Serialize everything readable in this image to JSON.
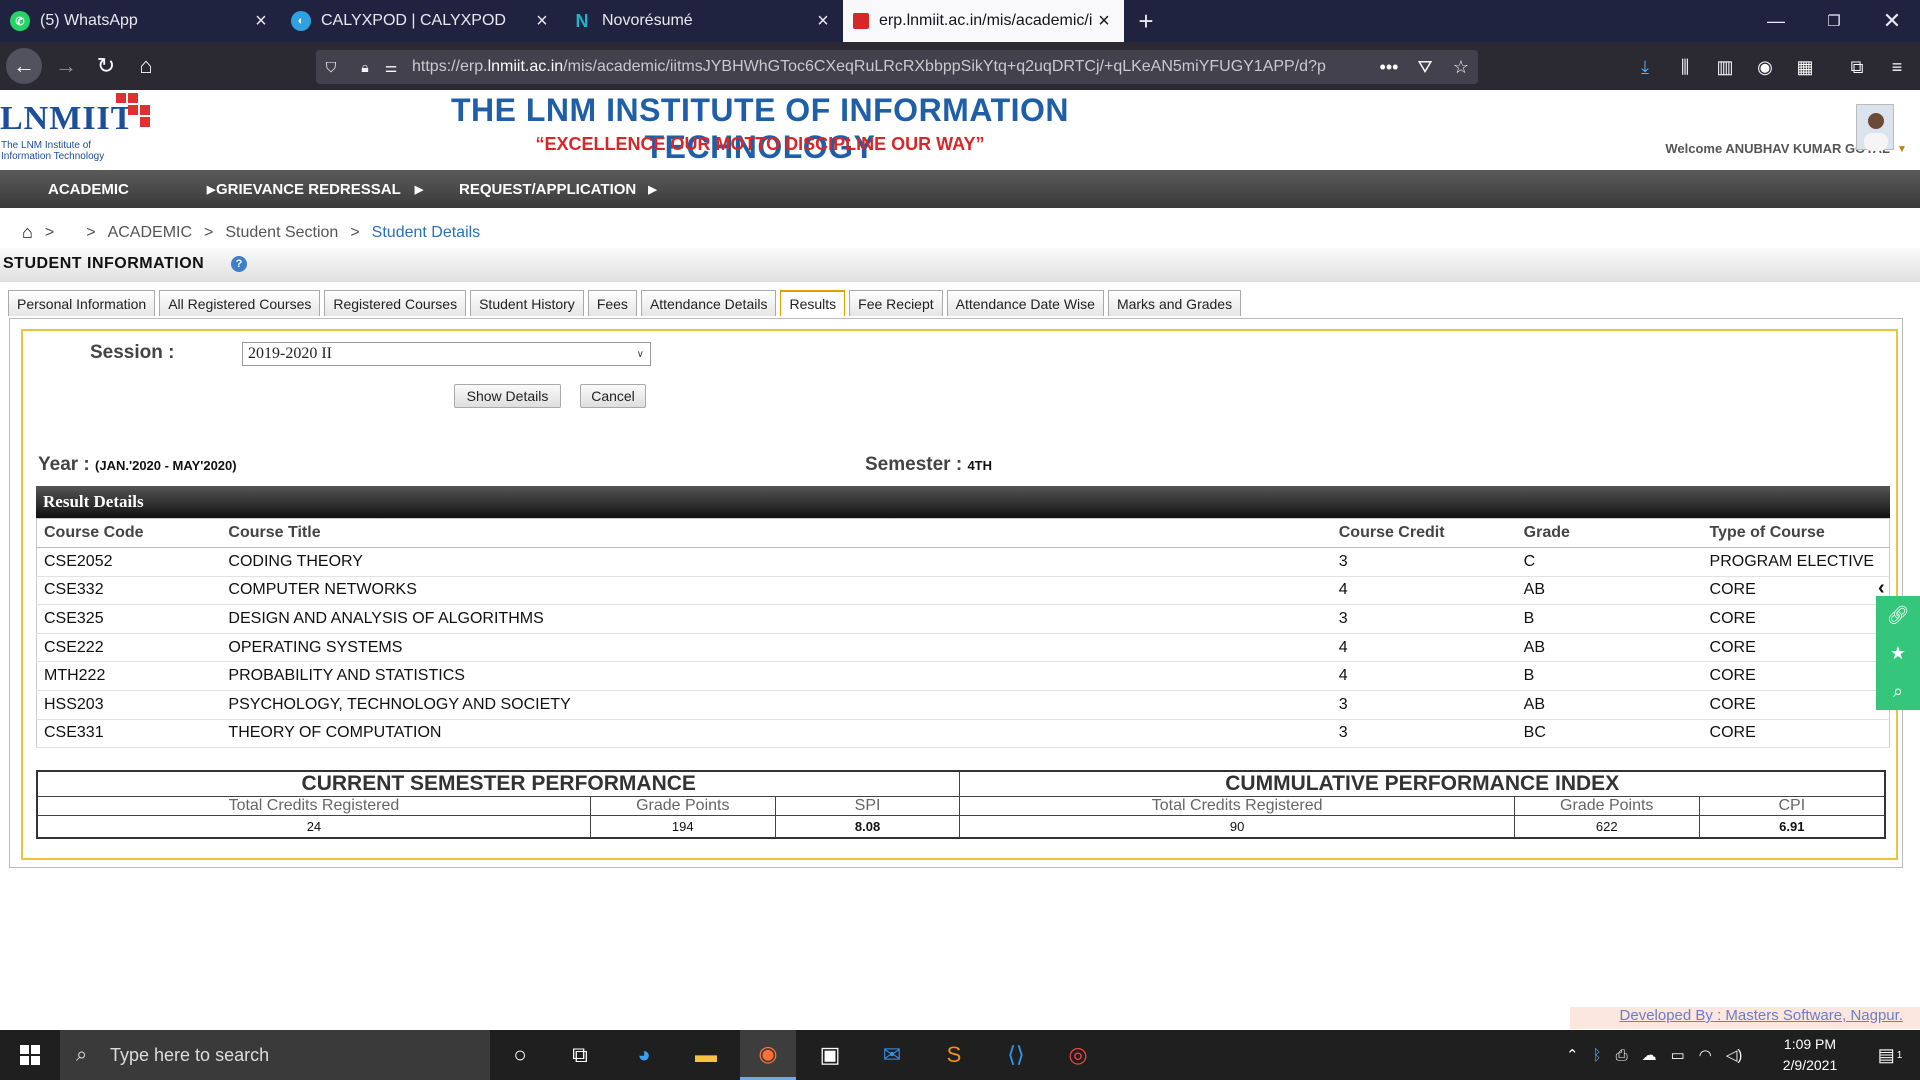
{
  "browser": {
    "tabs": [
      {
        "title": "(5) WhatsApp",
        "icon": "whatsapp-icon",
        "color": "#25d366"
      },
      {
        "title": "CALYXPOD | CALYXPOD",
        "icon": "calyxpod-icon",
        "color": "#2fa0e0"
      },
      {
        "title": "Novorésumé",
        "icon": "novoresume-icon",
        "color": "#1fb5c9"
      },
      {
        "title": "erp.lnmiit.ac.in/mis/academic/i",
        "icon": "lnmiit-favicon",
        "color": "#d62828"
      }
    ],
    "url_prefix": "https://erp.",
    "url_host": "lnmiit.ac.in",
    "url_rest": "/mis/academic/iitmsJYBHWhGToc6CXeqRuLRcRXbbppSikYtq+q2uqDRTCj/+qLKeAN5miYFUGY1APP/d?p"
  },
  "site": {
    "logo_text": "LNMIIT",
    "logo_sub": "The LNM Institute of Information Technology",
    "institute": "THE LNM INSTITUTE OF INFORMATION TECHNOLOGY",
    "motto": "“EXCELLENCE OUR MOTTO DISCIPLINE OUR WAY”",
    "welcome": "Welcome ANUBHAV KUMAR GOYAL",
    "menu": [
      "ACADEMIC",
      "GRIEVANCE REDRESSAL",
      "REQUEST/APPLICATION"
    ]
  },
  "breadcrumb": {
    "sep": ">",
    "items": [
      "ACADEMIC",
      "Student Section"
    ],
    "current": "Student Details"
  },
  "section_title": "STUDENT INFORMATION",
  "page_tabs": [
    "Personal Information",
    "All Registered Courses",
    "Registered Courses",
    "Student History",
    "Fees",
    "Attendance Details",
    "Results",
    "Fee Reciept",
    "Attendance Date Wise",
    "Marks and Grades"
  ],
  "form": {
    "session_label": "Session :",
    "session_value": "2019-2020 II",
    "show_btn": "Show Details",
    "cancel_btn": "Cancel"
  },
  "info": {
    "year_label": "Year :",
    "year_value": "(JAN.'2020 - MAY'2020)",
    "semester_label": "Semester :",
    "semester_value": "4TH"
  },
  "results": {
    "title": "Result Details",
    "columns": [
      "Course Code",
      "Course Title",
      "Course Credit",
      "Grade",
      "Type of Course"
    ],
    "rows": [
      [
        "CSE2052",
        "CODING THEORY",
        "3",
        "C",
        "PROGRAM ELECTIVE"
      ],
      [
        "CSE332",
        "COMPUTER NETWORKS",
        "4",
        "AB",
        "CORE"
      ],
      [
        "CSE325",
        "DESIGN AND ANALYSIS OF ALGORITHMS",
        "3",
        "B",
        "CORE"
      ],
      [
        "CSE222",
        "OPERATING SYSTEMS",
        "4",
        "AB",
        "CORE"
      ],
      [
        "MTH222",
        "PROBABILITY AND STATISTICS",
        "4",
        "B",
        "CORE"
      ],
      [
        "HSS203",
        "PSYCHOLOGY, TECHNOLOGY AND SOCIETY",
        "3",
        "AB",
        "CORE"
      ],
      [
        "CSE331",
        "THEORY OF COMPUTATION",
        "3",
        "BC",
        "CORE"
      ]
    ]
  },
  "performance": {
    "current_title": "CURRENT SEMESTER PERFORMANCE",
    "cumulative_title": "CUMMULATIVE PERFORMANCE INDEX",
    "h_total": "Total Credits Registered",
    "h_grade": "Grade Points",
    "h_spi": "SPI",
    "h_cpi": "CPI",
    "cur_credits": "24",
    "cur_points": "194",
    "spi": "8.08",
    "cum_credits": "90",
    "cum_points": "622",
    "cpi": "6.91"
  },
  "footer": {
    "developed_by": "Developed By : Masters Software, Nagpur."
  },
  "taskbar": {
    "search_placeholder": "Type here to search",
    "time": "1:09 PM",
    "date": "2/9/2021",
    "notifications": "1"
  }
}
